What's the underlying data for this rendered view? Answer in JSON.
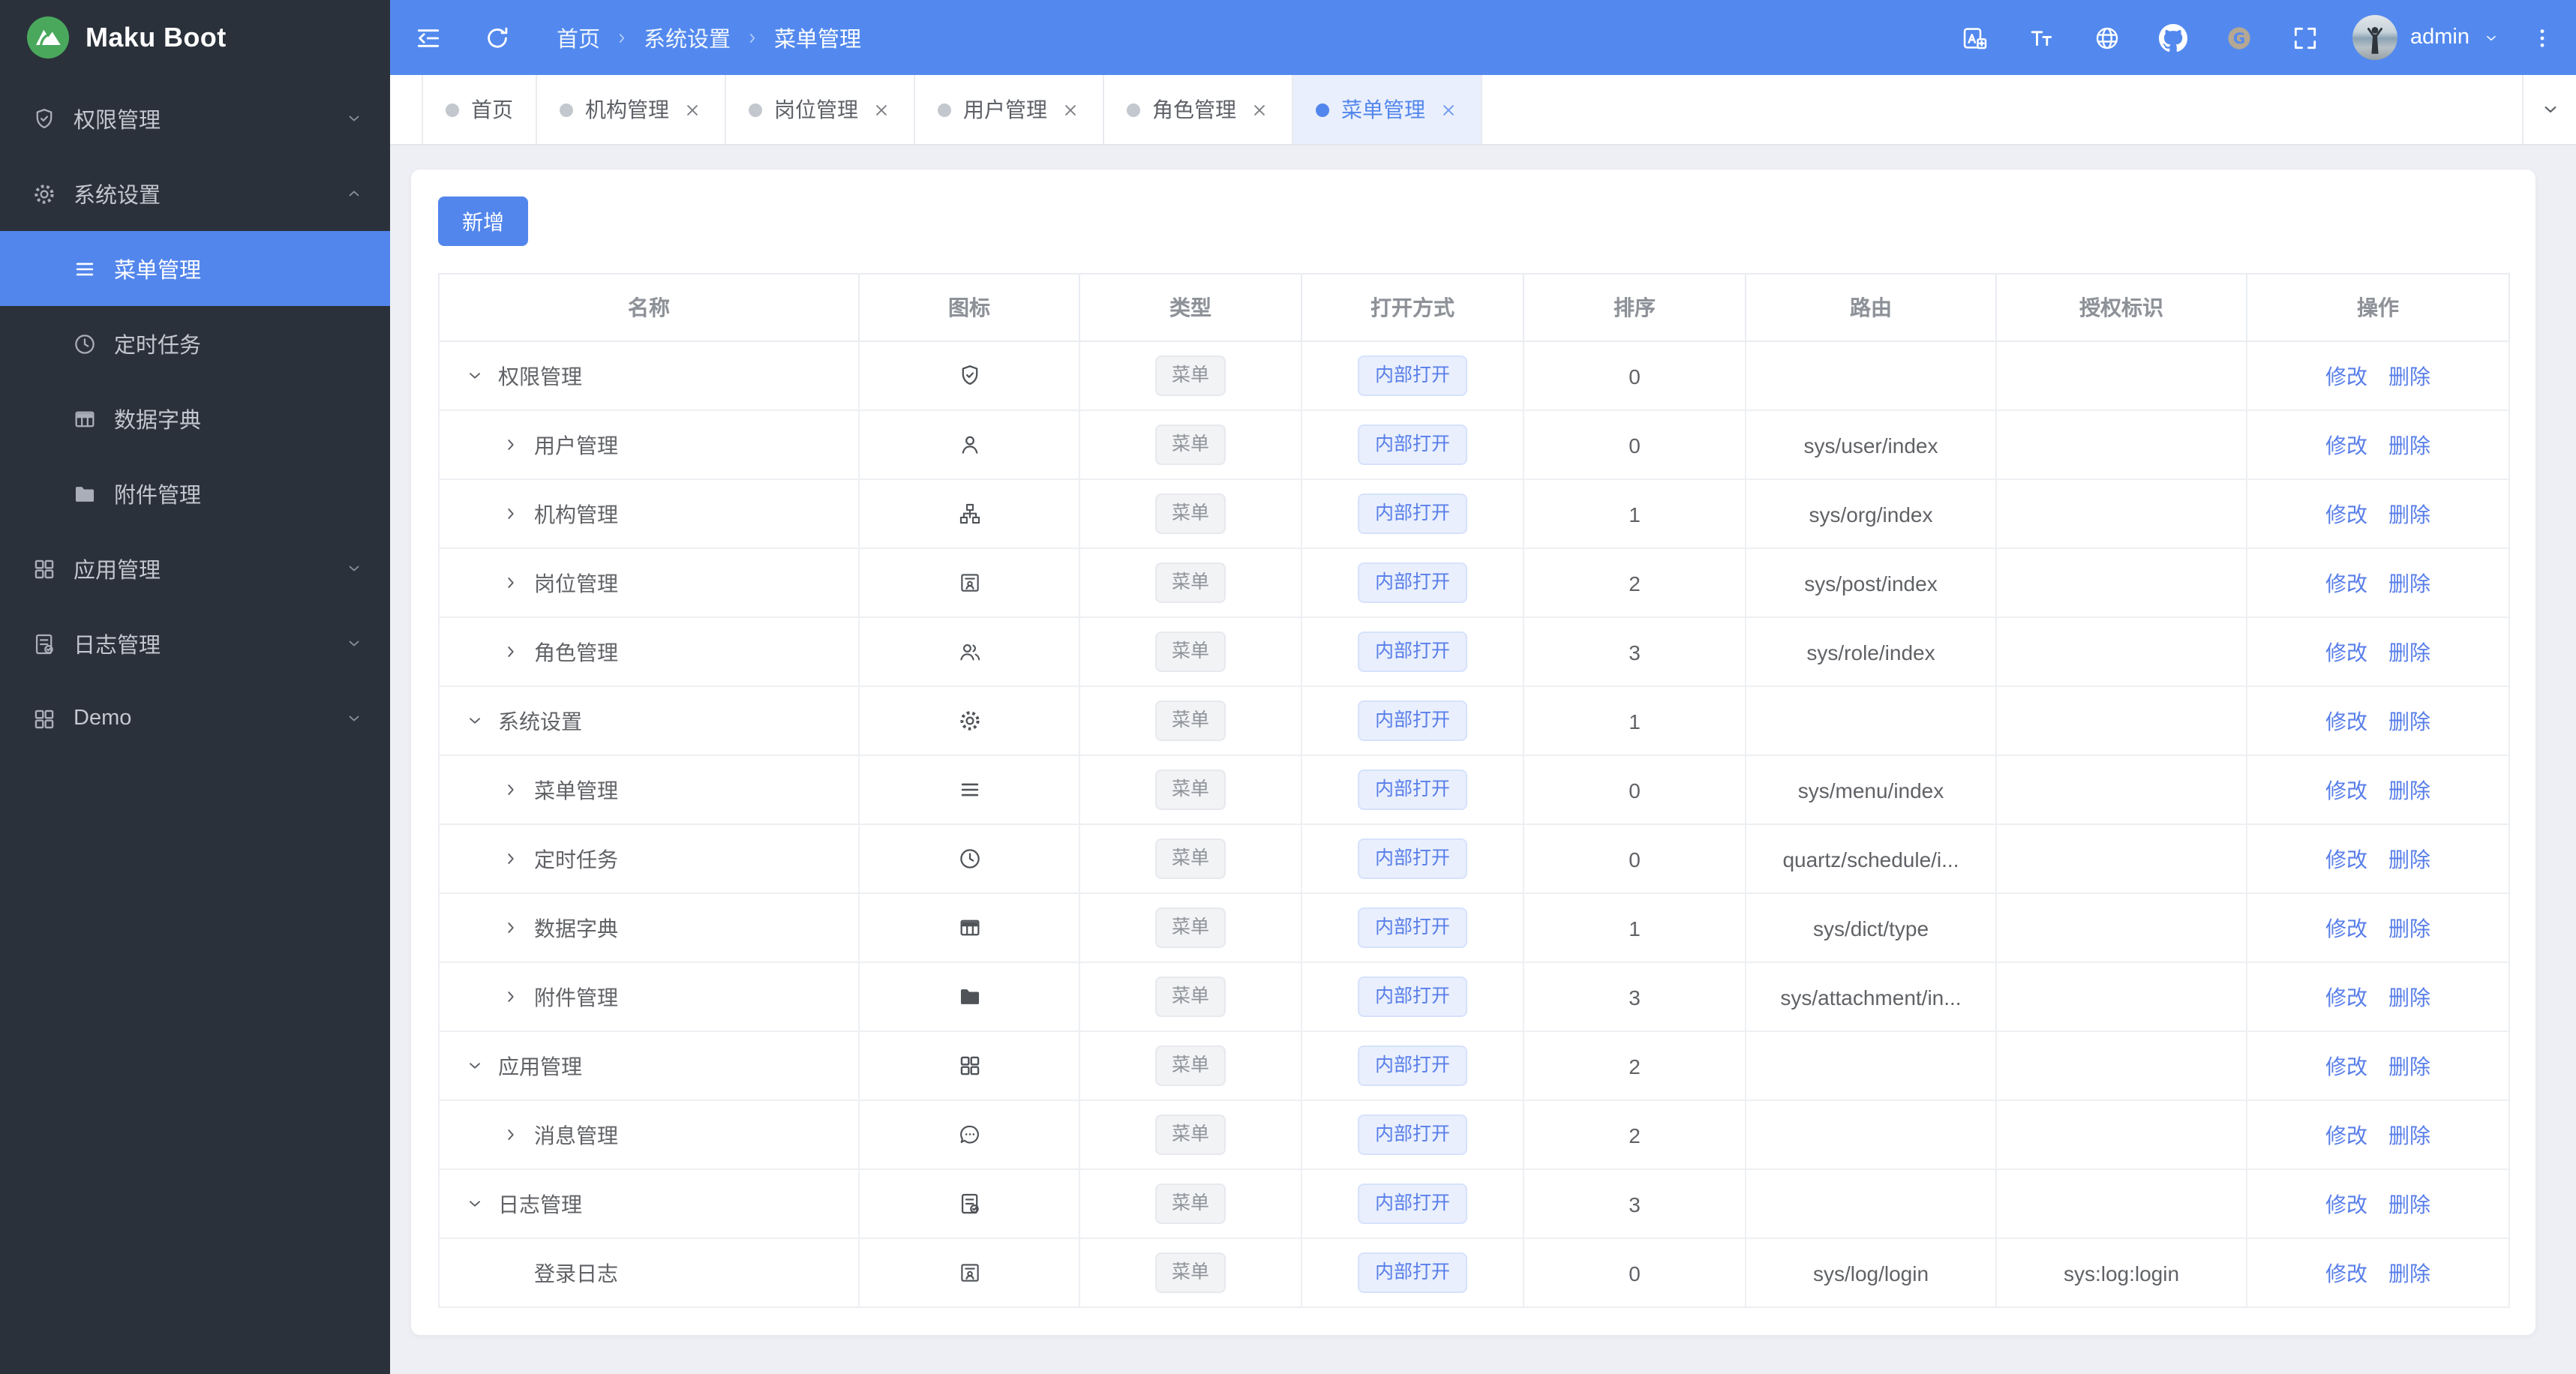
{
  "colors": {
    "header_bg": "#5389ee",
    "sidebar_bg": "#2b313b",
    "accent_blue": "#5286ec",
    "active_tab_bg": "#e9effd",
    "content_bg": "#edeff4",
    "link_blue": "#587ee9",
    "tag_gray_bg": "#f2f3f5",
    "tag_gray_text": "#8f9399",
    "tag_blue_bg": "#e9effd",
    "tag_blue_text": "#587ee9",
    "logo_green": "#4aa85c",
    "gitee_tan": "#b4a894"
  },
  "brand": {
    "name": "Maku Boot",
    "logo_icon": "mountain-logo-icon"
  },
  "header": {
    "left_icons": [
      "menu-collapse-icon",
      "refresh-icon"
    ],
    "breadcrumb": [
      "首页",
      "系统设置",
      "菜单管理"
    ],
    "right_icons": [
      "translate-icon",
      "font-size-icon",
      "globe-icon",
      "github-icon",
      "gitee-icon",
      "fullscreen-icon"
    ],
    "user": {
      "name": "admin",
      "menu_icon": "chevron-down-icon"
    },
    "more_icon": "kebab-menu-icon"
  },
  "sidebar": {
    "items": [
      {
        "key": "permission-management",
        "label": "权限管理",
        "icon": "shield-check-icon",
        "expanded": false
      },
      {
        "key": "system-settings",
        "label": "系统设置",
        "icon": "gear-icon",
        "expanded": true,
        "children": [
          {
            "key": "menu-management",
            "label": "菜单管理",
            "icon": "menu-lines-icon",
            "active": true
          },
          {
            "key": "scheduled-tasks",
            "label": "定时任务",
            "icon": "clock-icon",
            "active": false
          },
          {
            "key": "data-dictionary",
            "label": "数据字典",
            "icon": "table-icon",
            "active": false
          },
          {
            "key": "attachment-management",
            "label": "附件管理",
            "icon": "folder-icon",
            "active": false
          }
        ]
      },
      {
        "key": "app-management",
        "label": "应用管理",
        "icon": "grid-icon",
        "expanded": false
      },
      {
        "key": "log-management",
        "label": "日志管理",
        "icon": "log-doc-icon",
        "expanded": false
      },
      {
        "key": "demo",
        "label": "Demo",
        "icon": "grid-icon",
        "expanded": false
      }
    ]
  },
  "tabs": [
    {
      "key": "home",
      "label": "首页",
      "closable": false,
      "active": false
    },
    {
      "key": "org-management",
      "label": "机构管理",
      "closable": true,
      "active": false
    },
    {
      "key": "post-management",
      "label": "岗位管理",
      "closable": true,
      "active": false
    },
    {
      "key": "user-management",
      "label": "用户管理",
      "closable": true,
      "active": false
    },
    {
      "key": "role-management",
      "label": "角色管理",
      "closable": true,
      "active": false
    },
    {
      "key": "menu-management",
      "label": "菜单管理",
      "closable": true,
      "active": true
    }
  ],
  "tabbar": {
    "overflow_icon": "chevron-down-icon"
  },
  "toolbar": {
    "add_label": "新增"
  },
  "table": {
    "columns": [
      "名称",
      "图标",
      "类型",
      "打开方式",
      "排序",
      "路由",
      "授权标识",
      "操作"
    ],
    "actions": [
      {
        "key": "edit",
        "label": "修改"
      },
      {
        "key": "delete",
        "label": "删除"
      }
    ],
    "rows": [
      {
        "key": "permission-management",
        "name": "权限管理",
        "level": 0,
        "arrow": "expanded",
        "icon": "shield-check-icon",
        "type": "菜单",
        "open": "内部打开",
        "sort": "0",
        "route": "",
        "perm": ""
      },
      {
        "key": "user-management",
        "name": "用户管理",
        "level": 1,
        "arrow": "collapsed",
        "icon": "user-icon",
        "type": "菜单",
        "open": "内部打开",
        "sort": "0",
        "route": "sys/user/index",
        "perm": ""
      },
      {
        "key": "org-management",
        "name": "机构管理",
        "level": 1,
        "arrow": "collapsed",
        "icon": "org-icon",
        "type": "菜单",
        "open": "内部打开",
        "sort": "1",
        "route": "sys/org/index",
        "perm": ""
      },
      {
        "key": "post-management",
        "name": "岗位管理",
        "level": 1,
        "arrow": "collapsed",
        "icon": "badge-icon",
        "type": "菜单",
        "open": "内部打开",
        "sort": "2",
        "route": "sys/post/index",
        "perm": ""
      },
      {
        "key": "role-management",
        "name": "角色管理",
        "level": 1,
        "arrow": "collapsed",
        "icon": "users-icon",
        "type": "菜单",
        "open": "内部打开",
        "sort": "3",
        "route": "sys/role/index",
        "perm": ""
      },
      {
        "key": "system-settings",
        "name": "系统设置",
        "level": 0,
        "arrow": "expanded",
        "icon": "gear-icon",
        "type": "菜单",
        "open": "内部打开",
        "sort": "1",
        "route": "",
        "perm": ""
      },
      {
        "key": "menu-management",
        "name": "菜单管理",
        "level": 1,
        "arrow": "collapsed",
        "icon": "menu-lines-icon",
        "type": "菜单",
        "open": "内部打开",
        "sort": "0",
        "route": "sys/menu/index",
        "perm": ""
      },
      {
        "key": "scheduled-tasks",
        "name": "定时任务",
        "level": 1,
        "arrow": "collapsed",
        "icon": "clock-icon",
        "type": "菜单",
        "open": "内部打开",
        "sort": "0",
        "route": "quartz/schedule/i...",
        "perm": ""
      },
      {
        "key": "data-dictionary",
        "name": "数据字典",
        "level": 1,
        "arrow": "collapsed",
        "icon": "table-icon",
        "type": "菜单",
        "open": "内部打开",
        "sort": "1",
        "route": "sys/dict/type",
        "perm": ""
      },
      {
        "key": "attachment-management",
        "name": "附件管理",
        "level": 1,
        "arrow": "collapsed",
        "icon": "folder-icon",
        "type": "菜单",
        "open": "内部打开",
        "sort": "3",
        "route": "sys/attachment/in...",
        "perm": ""
      },
      {
        "key": "app-management",
        "name": "应用管理",
        "level": 0,
        "arrow": "expanded",
        "icon": "grid-icon",
        "type": "菜单",
        "open": "内部打开",
        "sort": "2",
        "route": "",
        "perm": ""
      },
      {
        "key": "message-management",
        "name": "消息管理",
        "level": 1,
        "arrow": "collapsed",
        "icon": "message-icon",
        "type": "菜单",
        "open": "内部打开",
        "sort": "2",
        "route": "",
        "perm": ""
      },
      {
        "key": "log-management",
        "name": "日志管理",
        "level": 0,
        "arrow": "expanded",
        "icon": "log-doc-icon",
        "type": "菜单",
        "open": "内部打开",
        "sort": "3",
        "route": "",
        "perm": ""
      },
      {
        "key": "login-log",
        "name": "登录日志",
        "level": 1,
        "arrow": "none",
        "icon": "badge-icon",
        "type": "菜单",
        "open": "内部打开",
        "sort": "0",
        "route": "sys/log/login",
        "perm": "sys:log:login"
      }
    ]
  }
}
